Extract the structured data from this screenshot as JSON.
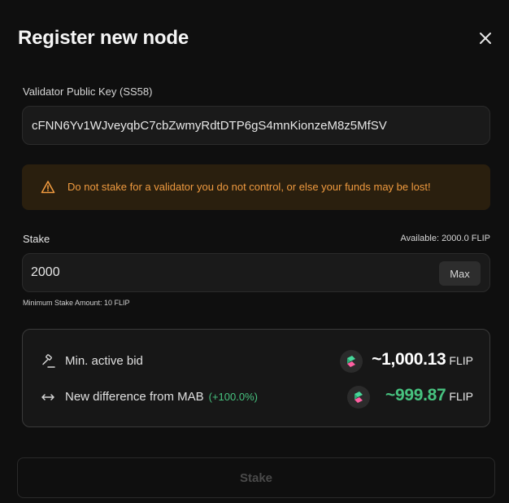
{
  "modal": {
    "title": "Register new node",
    "close_icon": "close-icon"
  },
  "validator": {
    "label": "Validator Public Key (SS58)",
    "value": "cFNN6Yv1WJveyqbC7cbZwmyRdtDTP6gS4mnKionzeM8z5MfSV"
  },
  "warning": {
    "icon": "warning-triangle-icon",
    "text": "Do not stake for a validator you do not control, or else your funds may be lost!",
    "color": "#ef9a3f"
  },
  "stake": {
    "label": "Stake",
    "available": "Available: 2000.0 FLIP",
    "value": "2000",
    "max_label": "Max",
    "min_note": "Minimum Stake Amount: 10 FLIP"
  },
  "summary": {
    "rows": [
      {
        "icon": "gavel-icon",
        "label": "Min. active bid",
        "token_icon": "flip-token-icon",
        "amount": "~1,000.13",
        "unit": "FLIP"
      },
      {
        "icon": "arrows-left-right-icon",
        "label": "New difference from MAB",
        "percent": "(+100.0%)",
        "token_icon": "flip-token-icon",
        "amount": "~999.87",
        "unit": "FLIP"
      }
    ],
    "positive_color": "#47c27f"
  },
  "submit": {
    "label": "Stake",
    "state": "disabled"
  }
}
